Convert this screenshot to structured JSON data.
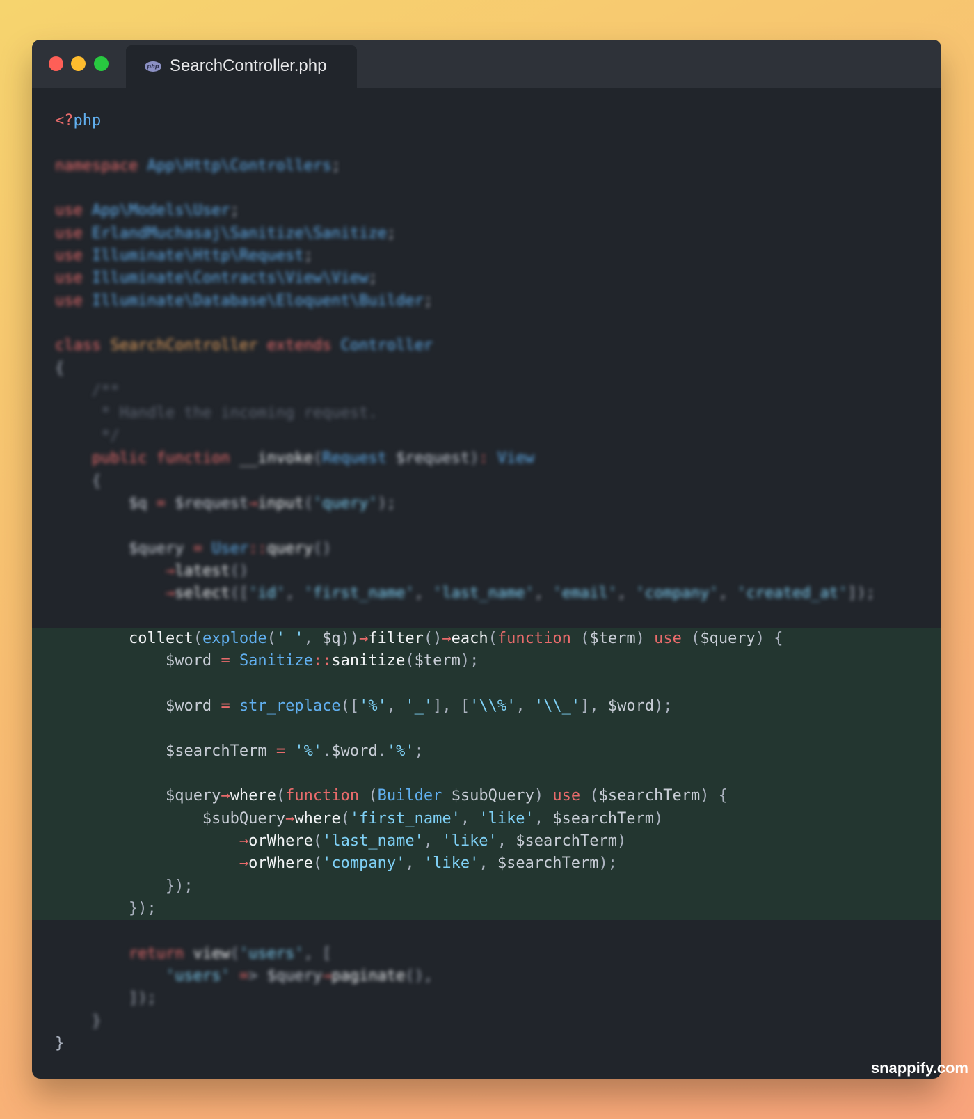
{
  "window": {
    "controls": [
      "close",
      "minimize",
      "maximize"
    ],
    "tab": {
      "icon": "php-icon",
      "icon_text": "php",
      "title": "SearchController.php"
    }
  },
  "code": {
    "lines": [
      "<?php",
      "",
      "namespace App\\Http\\Controllers;",
      "",
      "use App\\Models\\User;",
      "use ErlandMuchasaj\\Sanitize\\Sanitize;",
      "use Illuminate\\Http\\Request;",
      "use Illuminate\\Contracts\\View\\View;",
      "use Illuminate\\Database\\Eloquent\\Builder;",
      "",
      "class SearchController extends Controller",
      "{",
      "    /**",
      "     * Handle the incoming request.",
      "     */",
      "    public function __invoke(Request $request): View",
      "    {",
      "        $q = $request→input('query');",
      "",
      "        $query = User::query()",
      "            →latest()",
      "            →select(['id', 'first_name', 'last_name', 'email', 'company', 'created_at']);",
      "",
      "        collect(explode(' ', $q))→filter()→each(function ($term) use ($query) {",
      "            $word = Sanitize::sanitize($term);",
      "",
      "            $word = str_replace(['%', '_'], ['\\\\%', '\\\\_'], $word);",
      "",
      "            $searchTerm = '%'.$word.'%';",
      "",
      "            $query→where(function (Builder $subQuery) use ($searchTerm) {",
      "                $subQuery→where('first_name', 'like', $searchTerm)",
      "                    →orWhere('last_name', 'like', $searchTerm)",
      "                    →orWhere('company', 'like', $searchTerm);",
      "            });",
      "        });",
      "",
      "        return view('users', [",
      "            'users' => $query→paginate(),",
      "        ]);",
      "    }",
      "}"
    ],
    "highlighted_range": [
      24,
      36
    ],
    "blurred_range": [
      3,
      23
    ],
    "blurred_range_after": [
      37,
      41
    ]
  },
  "colors": {
    "background_start": "#f6d46e",
    "background_end": "#f9a47c",
    "editor_bg": "#21252b",
    "titlebar_bg": "#2e3239",
    "highlight_bg": "#233630",
    "keyword": "#e86b6b",
    "class": "#61afef",
    "string": "#7fd0f5"
  },
  "watermark": "snappify.com"
}
